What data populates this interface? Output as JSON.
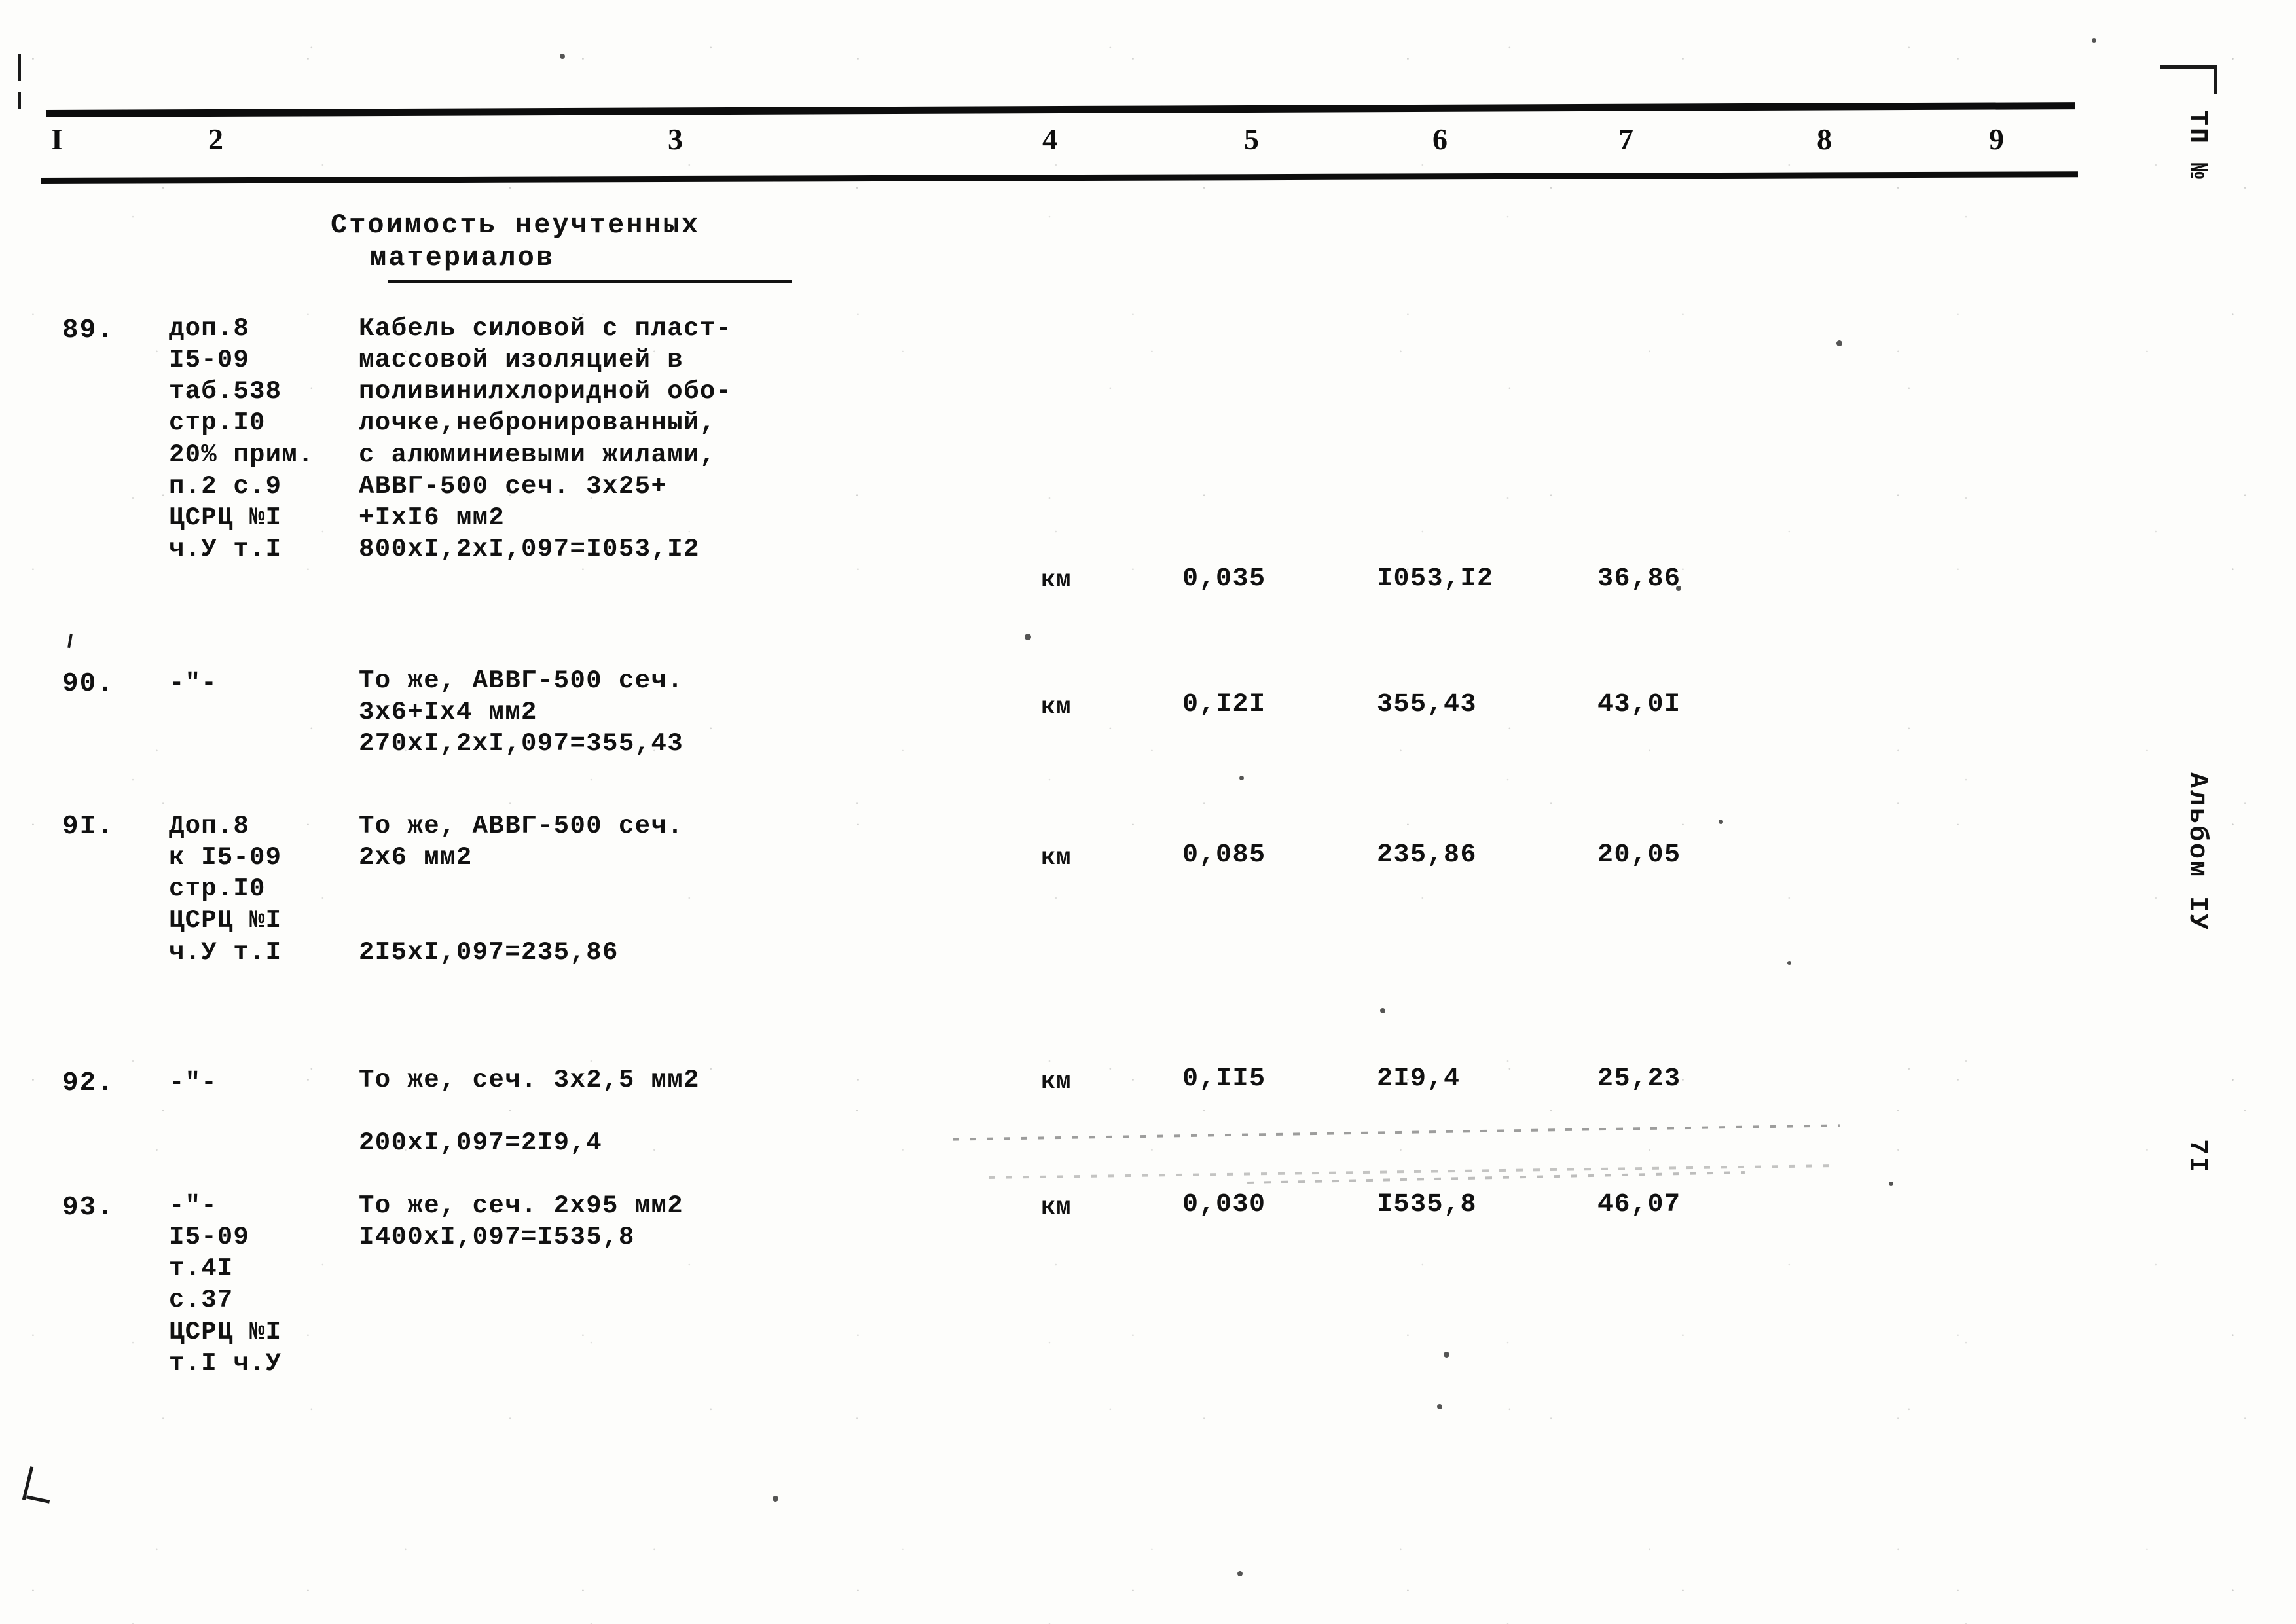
{
  "table": {
    "column_headers": [
      "I",
      "2",
      "3",
      "4",
      "5",
      "6",
      "7",
      "8",
      "9"
    ],
    "section_caption": {
      "line1": "Стоимость неучтенных",
      "line2": "материалов"
    },
    "rows": [
      {
        "number": "89.",
        "reference": "доп.8\nI5-09\nтаб.538\nстр.I0\n20% прим.\nп.2 с.9\nЦСРЦ №I\nч.У т.I",
        "description": "Кабель силовой с пласт-\nмассовой изоляцией в\nполивинилхлоридной обо-\nлочке,небронированный,\nс алюминиевыми жилами,\nАВВГ-500 сеч. 3х25+\n+IхI6 мм2\n800хI,2хI,097=I053,I2",
        "unit": "км",
        "quantity": "0,035",
        "price": "I053,I2",
        "total": "36,86"
      },
      {
        "number": "90.",
        "reference": "-\"-",
        "description": "То же, АВВГ-500 сеч.\n3х6+Iх4 мм2\n270хI,2хI,097=355,43",
        "unit": "км",
        "quantity": "0,I2I",
        "price": "355,43",
        "total": "43,0I"
      },
      {
        "number": "9I.",
        "reference": "Доп.8\nк I5-09\nстр.I0\nЦСРЦ №I\nч.У т.I",
        "description": "То же, АВВГ-500 сеч.\n2х6 мм2\n\n\n2I5хI,097=235,86",
        "unit": "км",
        "quantity": "0,085",
        "price": "235,86",
        "total": "20,05"
      },
      {
        "number": "92.",
        "reference": "-\"-",
        "description": "То же, сеч. 3х2,5 мм2\n\n200хI,097=2I9,4",
        "unit": "км",
        "quantity": "0,II5",
        "price": "2I9,4",
        "total": "25,23"
      },
      {
        "number": "93.",
        "reference": "-\"-\nI5-09\nт.4I\nс.37\nЦСРЦ №I\nт.I ч.У",
        "description": "То же, сеч. 2х95 мм2\nI400хI,097=I535,8",
        "unit": "км",
        "quantity": "0,030",
        "price": "I535,8",
        "total": "46,07"
      }
    ]
  },
  "margin": {
    "stamp_tp": "ТП №",
    "stamp_album": "Альбом IУ",
    "stamp_page": "7I"
  },
  "colors": {
    "ink": "#121212",
    "paper": "#fdfdfb"
  }
}
